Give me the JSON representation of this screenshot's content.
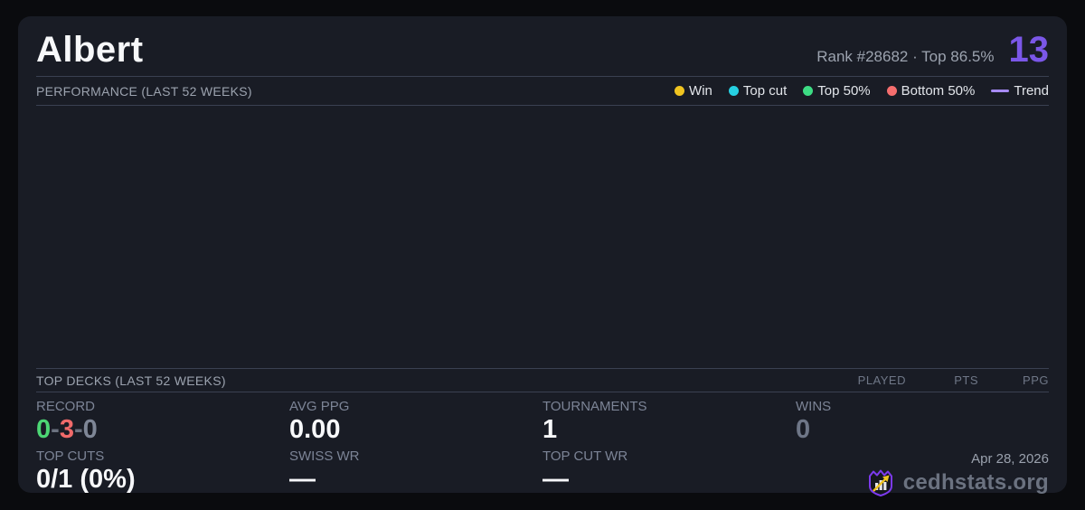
{
  "header": {
    "player_name": "Albert",
    "rank_text": "Rank #28682  ·  Top 86.5%",
    "highlight_number": "13",
    "highlight_color": "#7b57e8"
  },
  "performance": {
    "title": "PERFORMANCE (LAST 52 WEEKS)",
    "legend": [
      {
        "label": "Win",
        "color": "#f0c420",
        "swatch": "dot"
      },
      {
        "label": "Top cut",
        "color": "#26d0e2",
        "swatch": "dot"
      },
      {
        "label": "Top 50%",
        "color": "#3ddc84",
        "swatch": "dot"
      },
      {
        "label": "Bottom 50%",
        "color": "#f56e6e",
        "swatch": "dot"
      },
      {
        "label": "Trend",
        "color": "#a78bfa",
        "swatch": "line"
      }
    ],
    "chart": {
      "type": "scatter",
      "points": [],
      "note_empty": ""
    }
  },
  "top_decks": {
    "title": "TOP DECKS (LAST 52 WEEKS)",
    "columns": {
      "played": "PLAYED",
      "pts": "PTS",
      "ppg": "PPG"
    },
    "rows": []
  },
  "stats": {
    "record": {
      "label": "RECORD",
      "wins": "0",
      "losses": "3",
      "draws": "0",
      "separator": "-",
      "win_color": "#4cd674",
      "loss_color": "#f06a6a",
      "draw_color": "#7e8696",
      "separator_color": "#6b7280"
    },
    "avg_ppg": {
      "label": "AVG PPG",
      "value": "0.00"
    },
    "tournaments": {
      "label": "TOURNAMENTS",
      "value": "1"
    },
    "wins": {
      "label": "WINS",
      "value": "0",
      "value_color": "#6e7687"
    },
    "top_cuts": {
      "label": "TOP CUTS",
      "value": "0/1 (0%)"
    },
    "swiss_wr": {
      "label": "SWISS WR",
      "value": "—"
    },
    "top_cut_wr": {
      "label": "TOP CUT WR",
      "value": "—"
    }
  },
  "footer": {
    "date": "Apr 28, 2026",
    "brand": "cedhstats.org",
    "logo_outline_color": "#7c3aed",
    "logo_arrow_color": "#f0c420"
  }
}
